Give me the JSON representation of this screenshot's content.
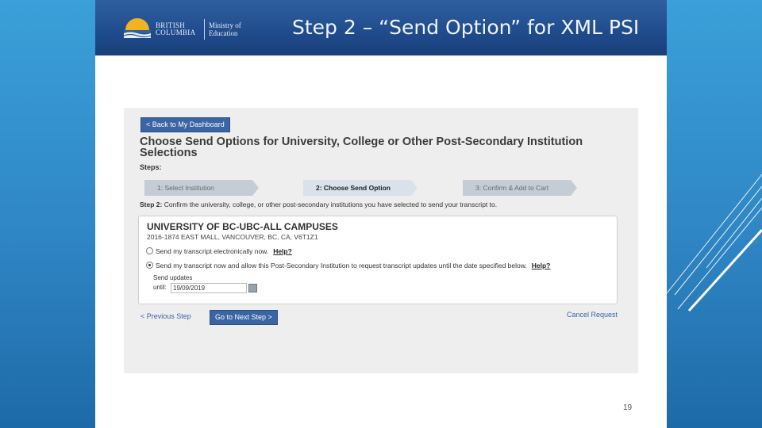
{
  "brand": {
    "province_line1": "BRITISH",
    "province_line2": "COLUMBIA",
    "ministry_line1": "Ministry of",
    "ministry_line2": "Education"
  },
  "slide_title": "Step 2 – “Send Option” for XML PSI",
  "page_number": "19",
  "app": {
    "back_button": "< Back to My Dashboard",
    "heading": "Choose Send Options for University, College or Other Post-Secondary Institution Selections",
    "steps_label": "Steps:",
    "steps": [
      {
        "label": "1: Select Institution",
        "state": "done"
      },
      {
        "label": "2: Choose Send Option",
        "state": "current"
      },
      {
        "label": "3: Confirm & Add to Cart",
        "state": "upcoming"
      }
    ],
    "instruction_prefix": "Step 2:",
    "instruction_text": " Confirm the university, college, or other post-secondary institutions you have selected to send your transcript to.",
    "institution": {
      "name": "UNIVERSITY OF BC-UBC-ALL CAMPUSES",
      "address": "2016-1874 EAST MALL, VANCOUVER, BC, CA, V6T1Z1"
    },
    "options": [
      {
        "label": "Send my transcript electronically now.",
        "help": "Help?",
        "selected": false
      },
      {
        "label": "Send my transcript now and allow this Post-Secondary Institution to request transcript updates until the date specified below.",
        "help": "Help?",
        "selected": true
      }
    ],
    "send_updates_label": "Send updates",
    "until_label": "until:",
    "until_value": "19/09/2019",
    "previous_step": "< Previous Step",
    "next_step": "Go to Next Step >",
    "cancel_request": "Cancel Request"
  },
  "colors": {
    "background": "#2f86c4",
    "banner": "#1f4b8c",
    "button": "#3b64a3"
  }
}
